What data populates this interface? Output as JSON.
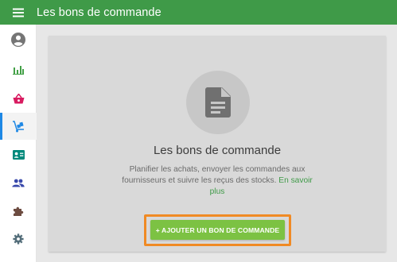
{
  "header": {
    "title": "Les bons de commande",
    "menu_icon": "hamburger-menu-icon"
  },
  "sidebar": {
    "items": [
      {
        "name": "account",
        "icon": "account-circle-icon",
        "color": "#757575"
      },
      {
        "name": "reports",
        "icon": "bar-chart-icon",
        "color": "#43a047"
      },
      {
        "name": "sales",
        "icon": "basket-icon",
        "color": "#d81b60"
      },
      {
        "name": "inventory",
        "icon": "dolly-boxes-icon",
        "color": "#1e88e5",
        "active": true
      },
      {
        "name": "customers",
        "icon": "contact-card-icon",
        "color": "#00897b"
      },
      {
        "name": "employees",
        "icon": "people-icon",
        "color": "#3949ab"
      },
      {
        "name": "integrations",
        "icon": "puzzle-icon",
        "color": "#6d4c41"
      },
      {
        "name": "settings",
        "icon": "gear-icon",
        "color": "#546e7a"
      }
    ]
  },
  "empty_state": {
    "icon": "document-icon",
    "title": "Les bons de commande",
    "description": "Planifier les achats, envoyer les commandes aux fournisseurs et suivre les reçus des stocks.",
    "learn_more": "En savoir plus",
    "add_button": "+ AJOUTER UN BON DE COMMANDE"
  },
  "colors": {
    "topbar": "#3f9a48",
    "button": "#7cc243",
    "highlight": "#f08a24",
    "link": "#3f9a48"
  }
}
